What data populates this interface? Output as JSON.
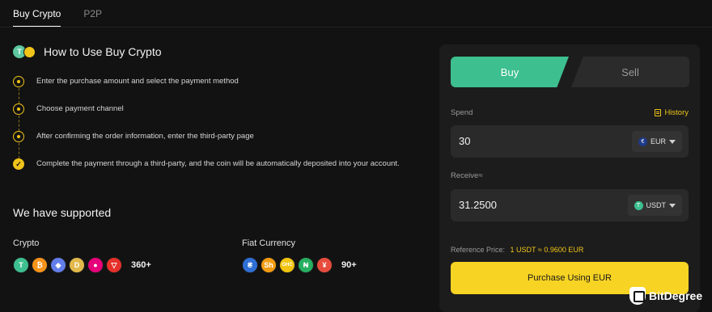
{
  "tabs": [
    {
      "label": "Buy Crypto",
      "active": true
    },
    {
      "label": "P2P",
      "active": false
    }
  ],
  "howto": {
    "title": "How to Use Buy Crypto",
    "icon_letter": "T",
    "steps": [
      "Enter the purchase amount and select the payment method",
      "Choose payment channel",
      "After confirming the order information, enter the third-party page",
      "Complete the payment through a third-party, and the coin will be automatically deposited into your account."
    ]
  },
  "supported": {
    "title": "We have supported",
    "crypto": {
      "label": "Crypto",
      "count": "360+",
      "coins": [
        {
          "name": "tether-icon",
          "glyph": "T",
          "color": "#3dbf8f"
        },
        {
          "name": "bitcoin-icon",
          "glyph": "₿",
          "color": "#f7931a"
        },
        {
          "name": "ethereum-icon",
          "glyph": "◆",
          "color": "#627eea"
        },
        {
          "name": "dogecoin-icon",
          "glyph": "D",
          "color": "#e1b84a"
        },
        {
          "name": "polkadot-icon",
          "glyph": "●",
          "color": "#e6007a"
        },
        {
          "name": "tron-icon",
          "glyph": "▽",
          "color": "#e5312a"
        }
      ]
    },
    "fiat": {
      "label": "Fiat Currency",
      "count": "90+",
      "coins": [
        {
          "name": "kzt-currency-icon",
          "glyph": "₴",
          "color": "#2f6fd6"
        },
        {
          "name": "sh-currency-icon",
          "glyph": "Sh",
          "color": "#f39c12"
        },
        {
          "name": "ghc-currency-icon",
          "glyph": "GHC",
          "color": "#f1c40f"
        },
        {
          "name": "ngn-currency-icon",
          "glyph": "₦",
          "color": "#27ae60"
        },
        {
          "name": "yen-currency-icon",
          "glyph": "¥",
          "color": "#e74c3c"
        }
      ]
    }
  },
  "trade": {
    "buy_label": "Buy",
    "sell_label": "Sell",
    "spend_label": "Spend",
    "history_label": "History",
    "spend_value": "30",
    "spend_currency": "EUR",
    "spend_currency_glyph": "€",
    "receive_label": "Receive≈",
    "receive_value": "31.2500",
    "receive_currency": "USDT",
    "receive_currency_glyph": "T",
    "reference_label": "Reference Price:",
    "reference_value": "1 USDT ≈ 0.9600 EUR",
    "purchase_label": "Purchase Using EUR"
  },
  "watermark": {
    "text": "BitDegree"
  },
  "colors": {
    "accent_green": "#3dbf8f",
    "accent_yellow": "#f7d323",
    "background": "#121212",
    "panel": "#1c1c1c"
  }
}
